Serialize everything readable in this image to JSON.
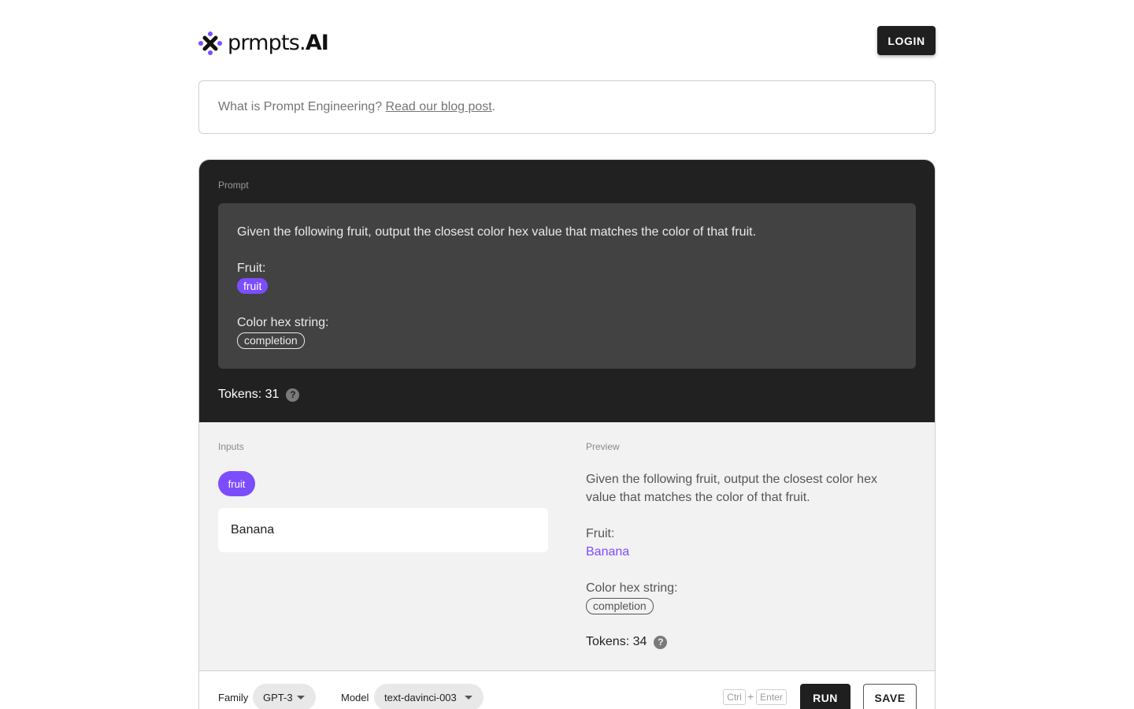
{
  "header": {
    "logo_text_light": "prmpts.",
    "logo_text_bold": "AI",
    "logo_icon": "molecule-logo-icon",
    "login_label": "LOGIN"
  },
  "banner": {
    "text": "What is Prompt Engineering? ",
    "link_text": "Read our blog post",
    "suffix": "."
  },
  "prompt": {
    "label": "Prompt",
    "line1": "Given the following fruit, output the closest color hex value that matches the color of that fruit.",
    "fruit_label": "Fruit:",
    "fruit_variable": "fruit",
    "color_label": "Color hex string:",
    "completion_chip": "completion",
    "tokens_text": "Tokens: 31",
    "help_icon_glyph": "?"
  },
  "inputs": {
    "label": "Inputs",
    "variable_chip": "fruit",
    "fruit_value": "Banana"
  },
  "preview": {
    "label": "Preview",
    "line1": "Given the following fruit, output the closest color hex value that matches the color of that fruit.",
    "fruit_label": "Fruit:",
    "fruit_value": "Banana",
    "color_label": "Color hex string:",
    "completion_chip": "completion",
    "tokens_text": "Tokens: 34",
    "help_icon_glyph": "?"
  },
  "toolbar": {
    "family_label": "Family",
    "family_value": "GPT-3",
    "model_label": "Model",
    "model_value": "text-davinci-003",
    "shortcut_ctrl": "Ctrl",
    "shortcut_plus": "+",
    "shortcut_enter": "Enter",
    "run_label": "RUN",
    "save_label": "SAVE"
  },
  "colors": {
    "accent": "#7c4dff",
    "dark_bg": "#212121",
    "prompt_box_bg": "#424242",
    "light_bg": "#f2f2f2"
  }
}
